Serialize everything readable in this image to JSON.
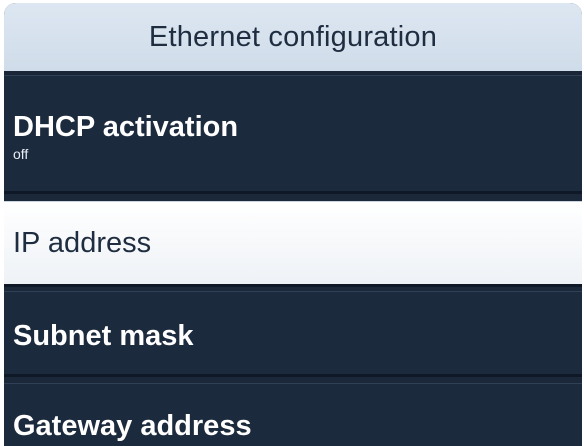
{
  "screen": {
    "title": "Ethernet configuration"
  },
  "menu": {
    "items": [
      {
        "label": "DHCP activation",
        "value": "off"
      },
      {
        "label": "IP address"
      },
      {
        "label": "Subnet mask"
      },
      {
        "label": "Gateway address"
      }
    ],
    "selected": "IP address"
  },
  "colors": {
    "panel_bg": "#1b283a",
    "title_bg": "#dde7f2",
    "title_text": "#1f2d40",
    "item_text": "#ffffff",
    "selected_bg": "#ffffff",
    "selected_text": "#1f2d40"
  }
}
